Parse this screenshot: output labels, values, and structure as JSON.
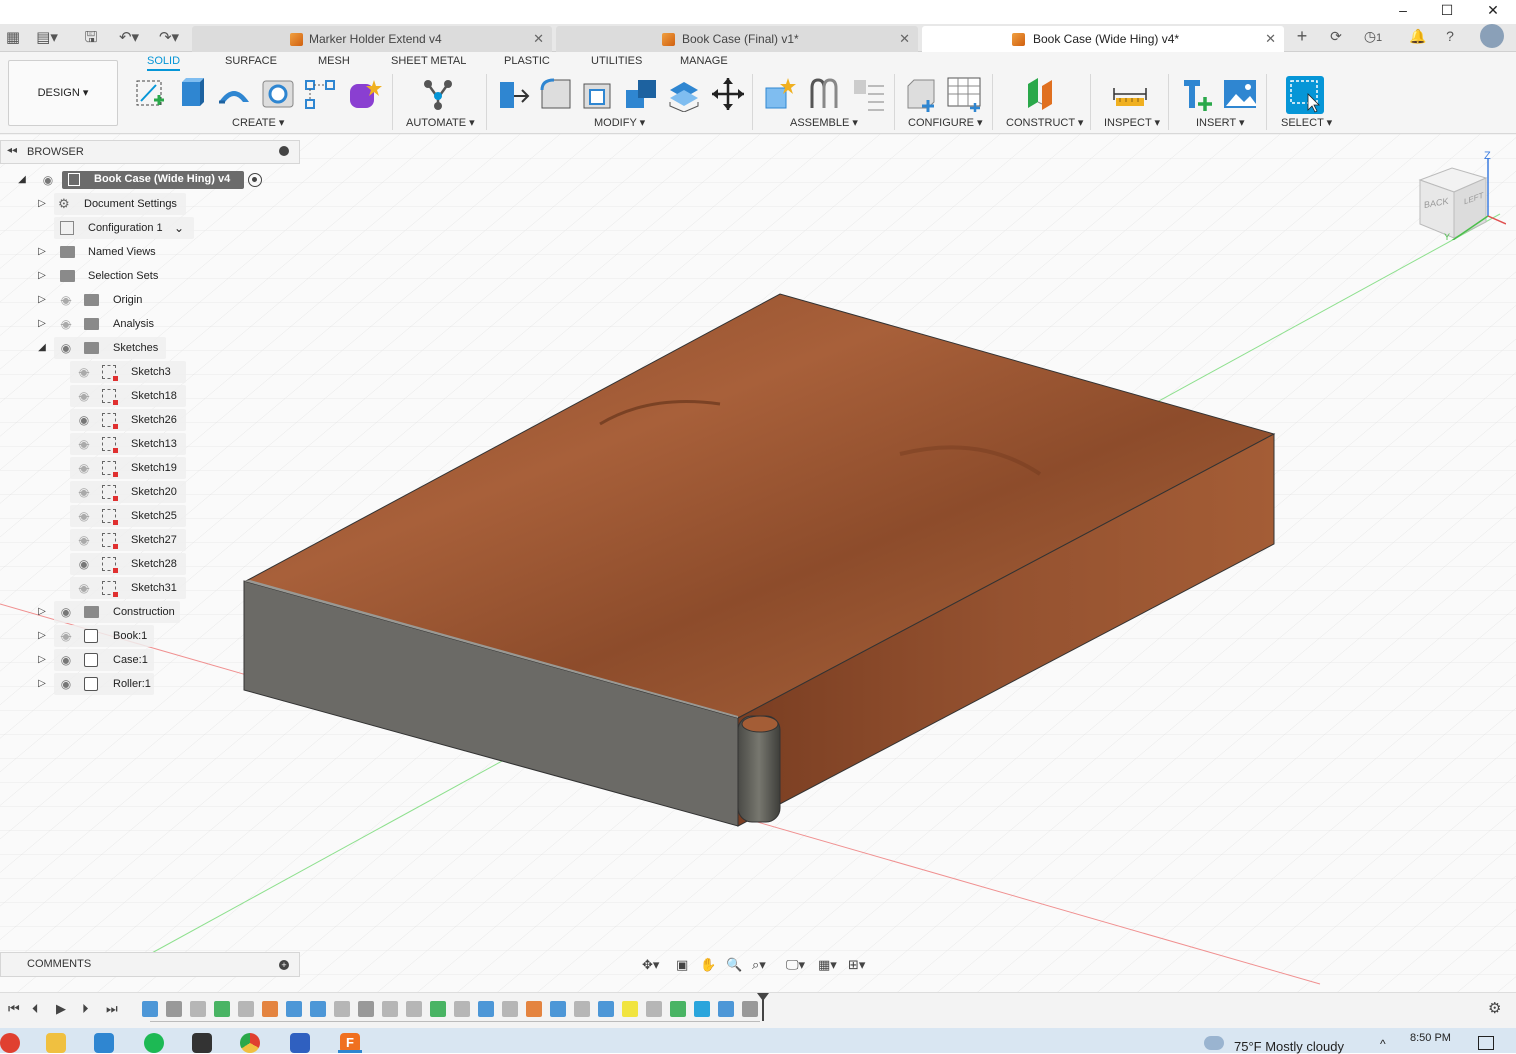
{
  "window": {
    "minimize": "–",
    "maximize": "☐",
    "close": "✕"
  },
  "tabs": [
    {
      "label": "Marker Holder Extend v4",
      "active": false
    },
    {
      "label": "Book Case (Final) v1*",
      "active": false
    },
    {
      "label": "Book Case (Wide Hing) v4*",
      "active": true
    }
  ],
  "header_right": {
    "jobs_count": "1"
  },
  "toolbar": {
    "design_label": "DESIGN",
    "workspace_tabs": [
      "SOLID",
      "SURFACE",
      "MESH",
      "SHEET METAL",
      "PLASTIC",
      "UTILITIES",
      "MANAGE"
    ],
    "groups": [
      "CREATE",
      "AUTOMATE",
      "MODIFY",
      "ASSEMBLE",
      "CONFIGURE",
      "CONSTRUCT",
      "INSPECT",
      "INSERT",
      "SELECT"
    ]
  },
  "browser": {
    "title": "BROWSER",
    "root": "Book Case (Wide Hing) v4",
    "document_settings": "Document Settings",
    "configuration": "Configuration 1",
    "named_views": "Named Views",
    "selection_sets": "Selection Sets",
    "origin": "Origin",
    "analysis": "Analysis",
    "sketches_label": "Sketches",
    "sketches": [
      {
        "name": "Sketch3",
        "visible": false
      },
      {
        "name": "Sketch18",
        "visible": false
      },
      {
        "name": "Sketch26",
        "visible": true
      },
      {
        "name": "Sketch13",
        "visible": false
      },
      {
        "name": "Sketch19",
        "visible": false
      },
      {
        "name": "Sketch20",
        "visible": false
      },
      {
        "name": "Sketch25",
        "visible": false
      },
      {
        "name": "Sketch27",
        "visible": false
      },
      {
        "name": "Sketch28",
        "visible": true
      },
      {
        "name": "Sketch31",
        "visible": false
      }
    ],
    "construction": "Construction",
    "bodies": [
      {
        "name": "Book:1",
        "visible": false
      },
      {
        "name": "Case:1",
        "visible": true
      },
      {
        "name": "Roller:1",
        "visible": true
      }
    ]
  },
  "viewcube": {
    "back": "BACK",
    "left": "LEFT",
    "z": "Z",
    "y": "Y"
  },
  "comments": {
    "label": "COMMENTS"
  },
  "taskbar": {
    "weather": "75°F  Mostly cloudy",
    "time": "8:50 PM",
    "date": "",
    "fusion_letter": "F"
  }
}
